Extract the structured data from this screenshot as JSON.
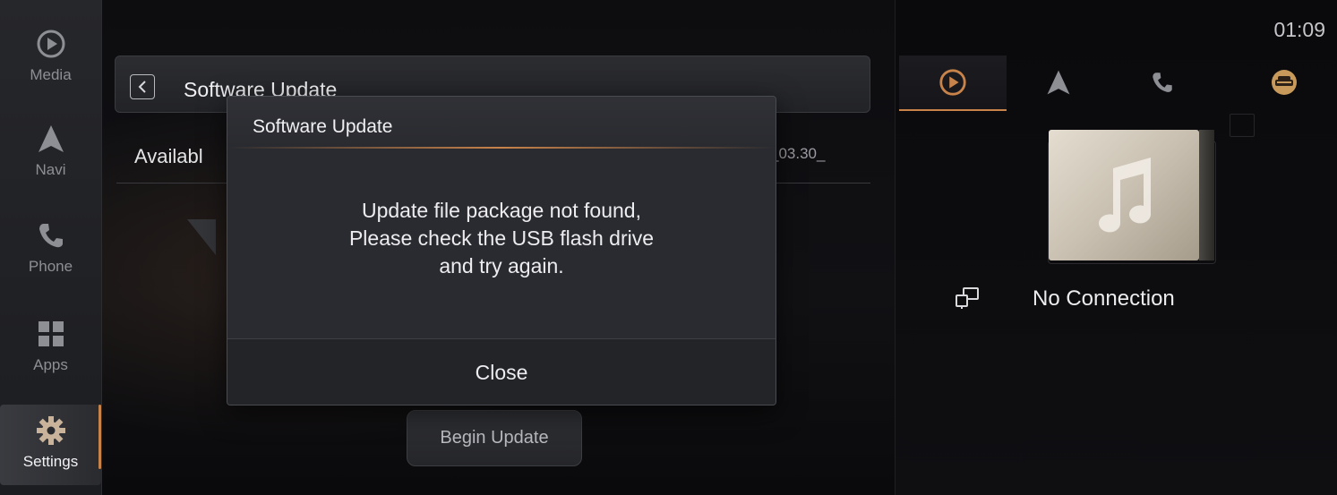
{
  "sidebar": {
    "items": [
      {
        "label": "Media",
        "icon": "play-circle-icon"
      },
      {
        "label": "Navi",
        "icon": "navigation-arrow-icon"
      },
      {
        "label": "Phone",
        "icon": "phone-icon"
      },
      {
        "label": "Apps",
        "icon": "apps-grid-icon"
      },
      {
        "label": "Settings",
        "icon": "gear-icon"
      }
    ],
    "active": "Settings"
  },
  "main": {
    "title": "Software Update",
    "available_label": "Availabl",
    "version_fragment": "_03.30_",
    "begin_button": "Begin Update"
  },
  "dialog": {
    "title": "Software Update",
    "message_lines": [
      "Update file package not found,",
      "Please check the USB flash drive",
      "and try again."
    ],
    "close_button": "Close"
  },
  "right_panel": {
    "clock": "01:09",
    "tabs": [
      {
        "icon": "play-circle-icon",
        "active": true
      },
      {
        "icon": "navigation-arrow-icon",
        "active": false
      },
      {
        "icon": "phone-icon",
        "active": false
      },
      {
        "icon": "car-icon",
        "active": false
      }
    ],
    "connection_status": "No Connection"
  },
  "colors": {
    "accent": "#c8834a",
    "background": "#0b0b0d",
    "dialog_bg": "#2a2b30"
  }
}
